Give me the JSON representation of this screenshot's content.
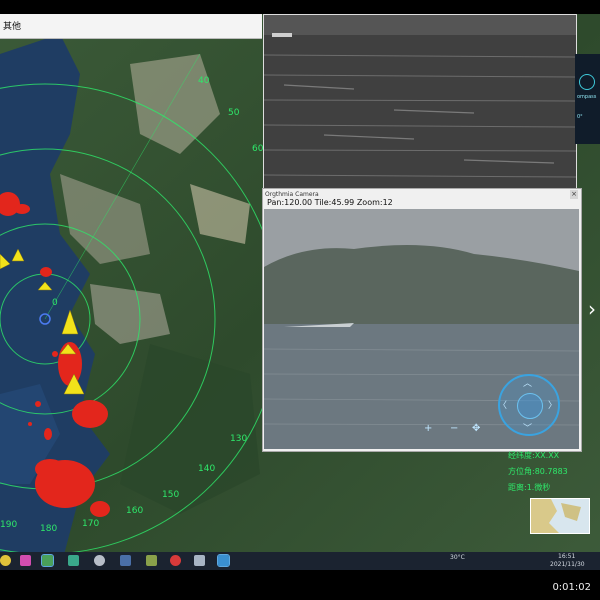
{
  "menubar": {
    "title": "其他"
  },
  "radar": {
    "range_labels": [
      "40",
      "50",
      "60",
      "130",
      "140",
      "150",
      "160",
      "170",
      "180",
      "190"
    ],
    "target_label": "0"
  },
  "camera_window": {
    "title": "Orgthmia Camera",
    "close_glyph": "×",
    "readout": "Pan:120.00 Tile:45.99 Zoom:12",
    "ptz": {
      "up": "︿",
      "down": "﹀",
      "left": "〈",
      "right": "〉",
      "zoom_in": "+",
      "zoom_out": "−",
      "move": "✥"
    }
  },
  "right_panel": {
    "compass_label": "ompass",
    "value_label": "0°"
  },
  "target_info": {
    "line1": "经纬度:XX.XX",
    "line2": "方位角:80.7883",
    "line3": "距离:1.微秒"
  },
  "taskbar": {
    "weather": "30°C",
    "time": "16:51",
    "date": "2021/11/30",
    "icons": [
      "chrome-icon",
      "pen-icon",
      "map-app-icon",
      "camera-app-icon",
      "settings-icon",
      "video-icon",
      "folder-icon",
      "record-icon",
      "files-icon",
      "signal-app-icon"
    ]
  },
  "video_timer": "0:01:02",
  "colors": {
    "radar_ring": "#2ee86a",
    "track_red": "#e3261c",
    "track_yellow": "#f2e21a",
    "ptz_blue": "#3aa3e0"
  }
}
